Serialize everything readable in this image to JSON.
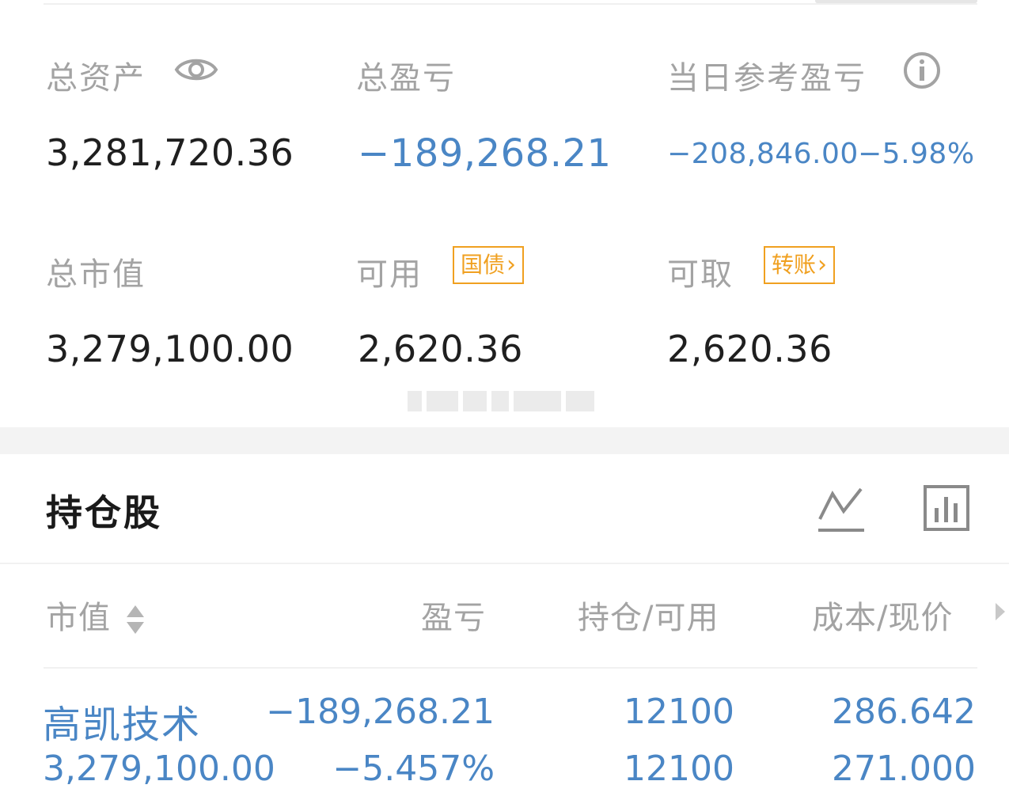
{
  "summary": {
    "total_assets_label": "总资产",
    "total_assets_value": "3,281,720.36",
    "total_pnl_label": "总盈亏",
    "total_pnl_value": "−189,268.21",
    "daily_pnl_label": "当日参考盈亏",
    "daily_pnl_value": "−208,846.00",
    "daily_pnl_percent": "−5.98%",
    "market_value_label": "总市值",
    "market_value_value": "3,279,100.00",
    "available_label": "可用",
    "available_value": "2,620.36",
    "treasury_button": "国债",
    "withdrawable_label": "可取",
    "withdrawable_value": "2,620.36",
    "transfer_button": "转账"
  },
  "holdings": {
    "title": "持仓股",
    "columns": {
      "market_value": "市值",
      "pnl": "盈亏",
      "position": "持仓/可用",
      "cost_price": "成本/现价"
    },
    "rows": [
      {
        "name": "高凯技术",
        "market_value": "3,279,100.00",
        "pnl": "−189,268.21",
        "pnl_percent": "−5.457%",
        "position": "12100",
        "available": "12100",
        "cost": "286.642",
        "price": "271.000"
      }
    ]
  },
  "colors": {
    "loss_blue": "#4a86c5",
    "label_gray": "#a3a3a3",
    "accent_orange": "#f0a020"
  },
  "icons": [
    "eye-icon",
    "info-icon",
    "chevron-right-icon",
    "line-chart-icon",
    "bar-chart-icon",
    "sort-icon"
  ]
}
